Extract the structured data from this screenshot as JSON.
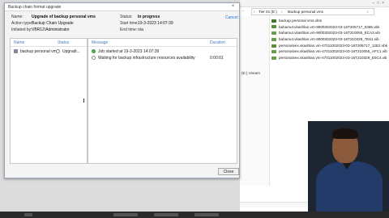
{
  "dialog": {
    "title": "Backup chain format upgrade",
    "cancel_link": "Cancel",
    "info": {
      "name_label": "Name:",
      "name_value": "Upgrade of backup personal vms",
      "action_type_label": "Action type:",
      "action_type_value": "Backup Chain Upgrade",
      "initiated_by_label": "Initiated by:",
      "initiated_by_value": "VBR12\\Administrator",
      "status_label": "Status:",
      "status_value": "In progress",
      "start_time_label": "Start time:",
      "start_time_value": "19-3-2023 14:07:39",
      "end_time_label": "End time:",
      "end_time_value": "n/a"
    },
    "objects_panel": {
      "col_name": "Name",
      "col_status": "Status",
      "rows": [
        {
          "name": "backup personal vms",
          "status": "Upgradi..."
        }
      ]
    },
    "log_panel": {
      "col_message": "Message",
      "col_duration": "Duration",
      "rows": [
        {
          "message": "Job started at 19-3-2023 14:07:39",
          "duration": "",
          "state": "success"
        },
        {
          "message": "Waiting for backup infrastructure resources availability",
          "duration": "0:00:01",
          "state": "pending"
        }
      ]
    },
    "close_button": "Close"
  },
  "explorer": {
    "breadcrumb": [
      "›",
      "Tier 01 (E:)",
      "›",
      "Backup personal vms",
      "›"
    ],
    "sidebar": [
      "(E:) Veeam"
    ],
    "files": [
      "backup personal vms.vbm",
      "bahamut.vkashlan.vm-9000302023-03-16T205717_6385.vbk",
      "bahamut.vkashlan.vm-9000302023-03-16T210055_ECA3.vib",
      "bahamut.vkashlan.vm-9000302023-03-16T210329_7E61.vib",
      "personalvex.vkashlan.vm-47011002023-03-16T205717_12E2.vbk",
      "personalvex.vkashlan.vm-47011002023-03-16T210055_AFC1.vib",
      "personalvex.vkashlan.vm-47011002023-03-16T210329_E0C4.vib"
    ]
  }
}
